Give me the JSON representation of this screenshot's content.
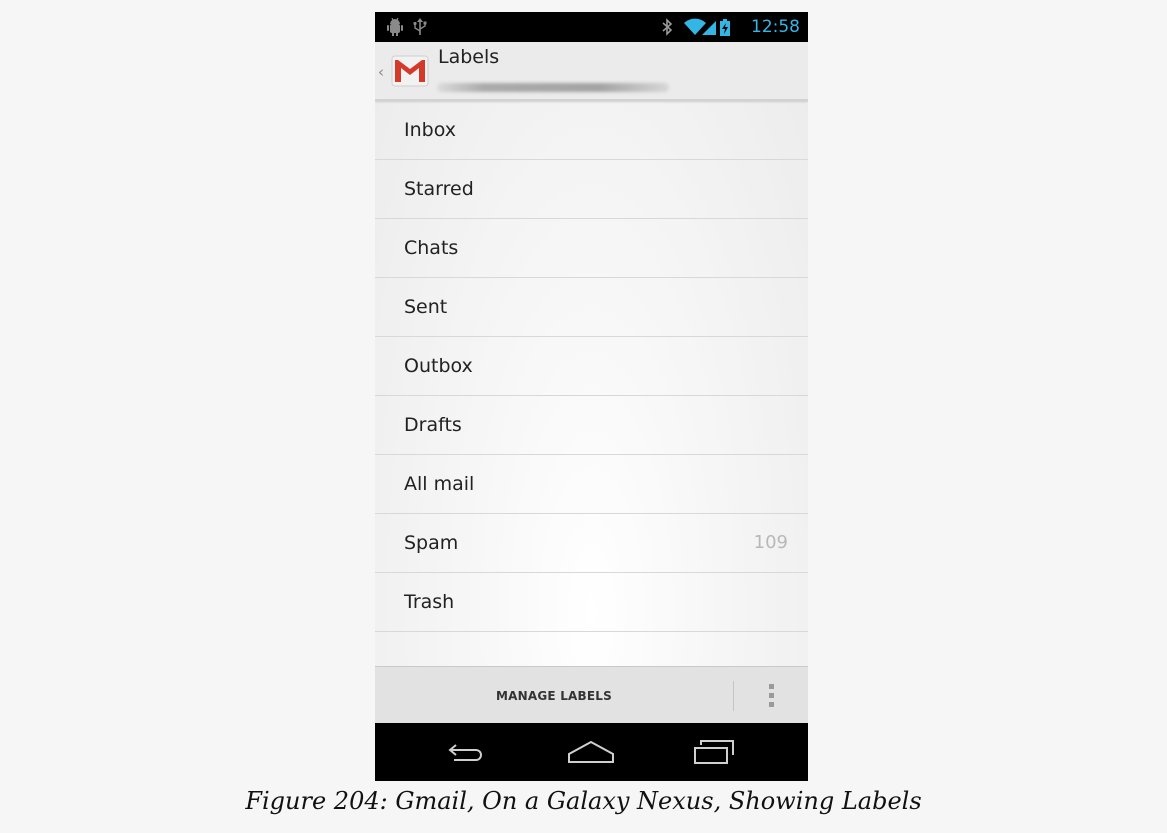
{
  "status_bar": {
    "time": "12:58",
    "left_icons": [
      "android-debug-icon",
      "usb-icon"
    ],
    "right_icons": [
      "bluetooth-icon",
      "wifi-icon",
      "signal-icon",
      "battery-icon"
    ],
    "accent_color": "#33b5e5"
  },
  "action_bar": {
    "title": "Labels",
    "app_icon": "gmail-icon",
    "account_redacted": true
  },
  "labels": [
    {
      "name": "Inbox",
      "count": ""
    },
    {
      "name": "Starred",
      "count": ""
    },
    {
      "name": "Chats",
      "count": ""
    },
    {
      "name": "Sent",
      "count": ""
    },
    {
      "name": "Outbox",
      "count": ""
    },
    {
      "name": "Drafts",
      "count": ""
    },
    {
      "name": "All mail",
      "count": ""
    },
    {
      "name": "Spam",
      "count": "109"
    },
    {
      "name": "Trash",
      "count": ""
    }
  ],
  "bottom_bar": {
    "manage_labels": "MANAGE LABELS",
    "overflow_icon": "overflow-menu-icon"
  },
  "nav_bar": {
    "icons": [
      "back-icon",
      "home-icon",
      "recent-apps-icon"
    ]
  },
  "caption": "Figure 204: Gmail, On a Galaxy Nexus, Showing Labels"
}
